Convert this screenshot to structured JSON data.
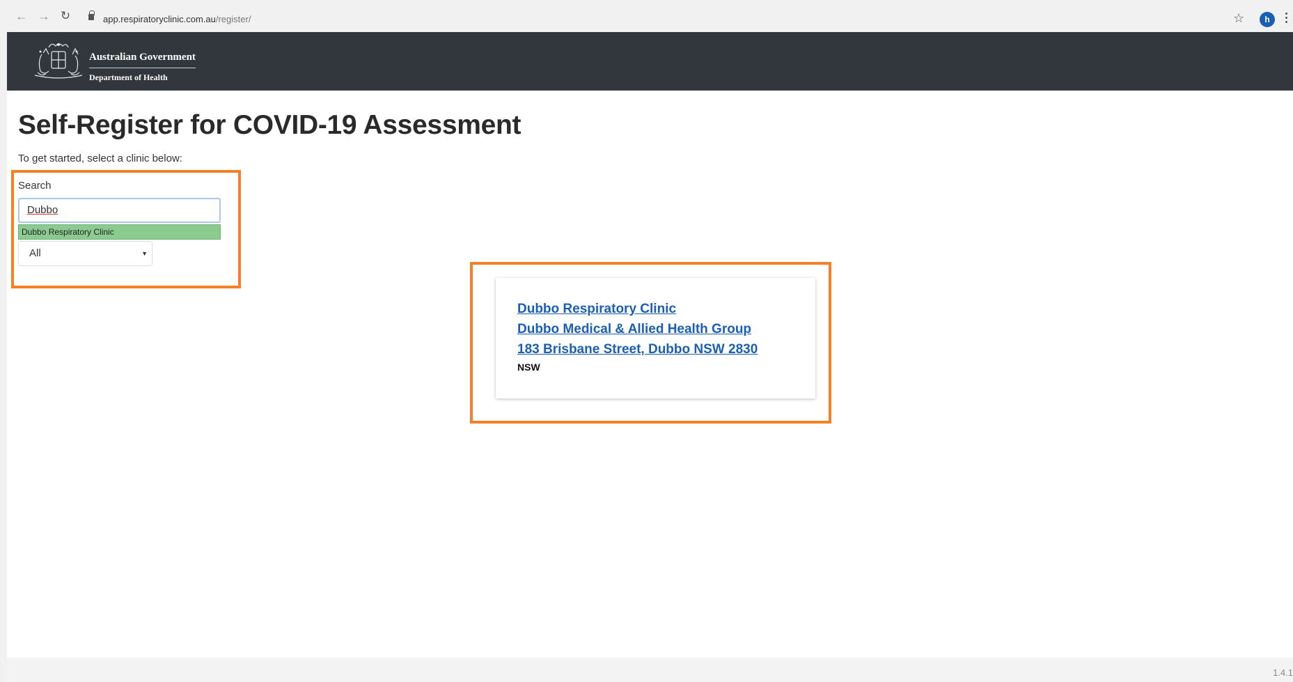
{
  "browser": {
    "url_host": "app.respiratoryclinic.com.au",
    "url_path": "/register/",
    "avatar_initial": "h",
    "icons": [
      "back-arrow-icon",
      "forward-arrow-icon",
      "reload-icon",
      "lock-icon",
      "star-icon",
      "kebab-menu-icon"
    ]
  },
  "header": {
    "gov_line1": "Australian Government",
    "gov_line2": "Department of Health",
    "crest": "coat-of-arms-logo",
    "background": "#32373d"
  },
  "main": {
    "title": "Self-Register for COVID-19 Assessment",
    "intro": "To get started, select a clinic below:",
    "search_label": "Search",
    "search_value": "Dubbo",
    "suggestion": "Dubbo Respiratory Clinic",
    "state_select": "All"
  },
  "result_card": {
    "clinic_name": "Dubbo Respiratory Clinic",
    "practice_name": "Dubbo Medical & Allied Health Group",
    "address": "183 Brisbane Street, Dubbo NSW 2830",
    "state": "NSW"
  },
  "footer": {
    "version": "1.4.1"
  },
  "colors": {
    "highlight": "#f58025",
    "link": "#1a5fb4",
    "suggestion_bg": "#8bcb8f"
  }
}
